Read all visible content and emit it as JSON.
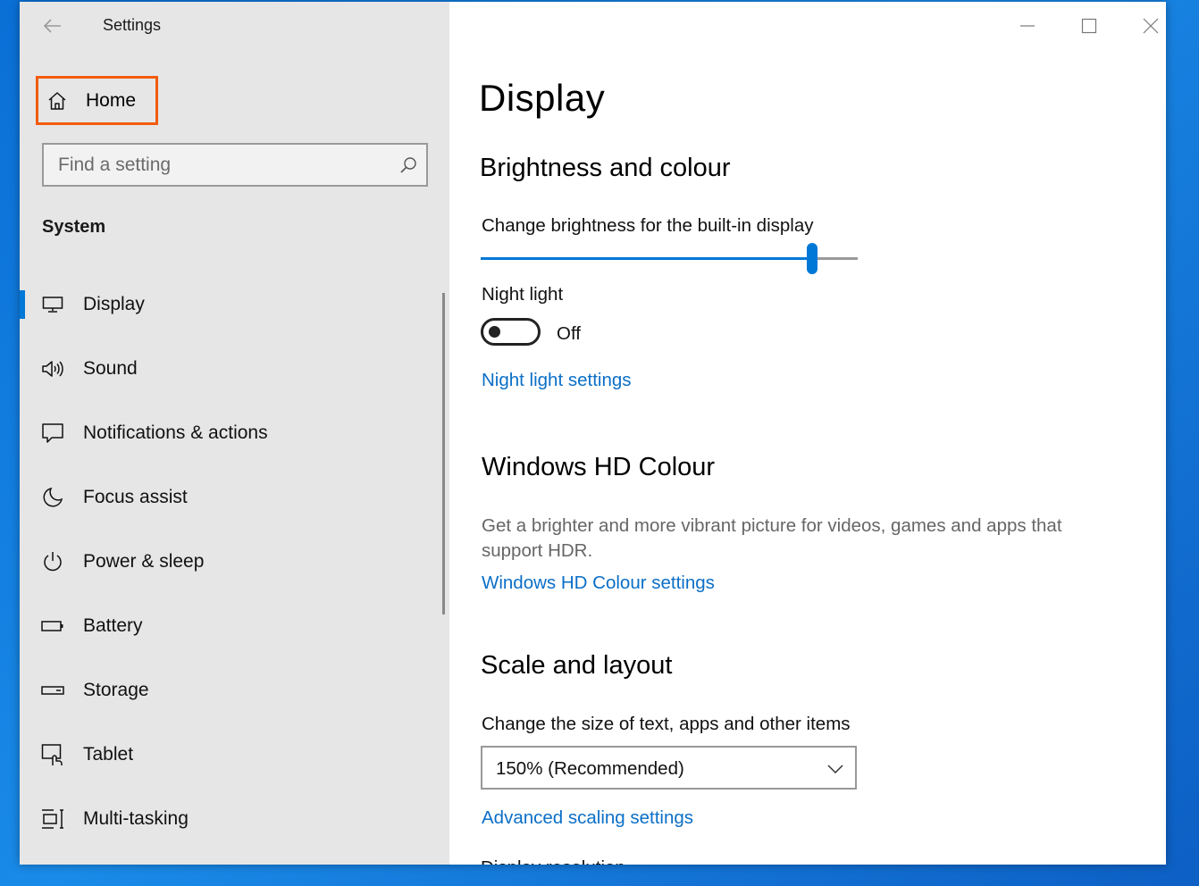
{
  "window": {
    "title": "Settings"
  },
  "sidebar": {
    "home_label": "Home",
    "search_placeholder": "Find a setting",
    "section_label": "System",
    "items": [
      {
        "label": "Display",
        "icon": "monitor-icon",
        "active": true
      },
      {
        "label": "Sound",
        "icon": "speaker-icon"
      },
      {
        "label": "Notifications & actions",
        "icon": "notification-icon"
      },
      {
        "label": "Focus assist",
        "icon": "moon-icon"
      },
      {
        "label": "Power & sleep",
        "icon": "power-icon"
      },
      {
        "label": "Battery",
        "icon": "battery-icon"
      },
      {
        "label": "Storage",
        "icon": "storage-icon"
      },
      {
        "label": "Tablet",
        "icon": "tablet-icon"
      },
      {
        "label": "Multi-tasking",
        "icon": "multitasking-icon"
      }
    ]
  },
  "main": {
    "page_title": "Display",
    "brightness": {
      "heading": "Brightness and colour",
      "slider_label": "Change brightness for the built-in display",
      "slider_value": 0.88,
      "night_light_label": "Night light",
      "night_light_state": "Off",
      "night_light_link": "Night light settings"
    },
    "hdr": {
      "heading": "Windows HD Colour",
      "description": "Get a brighter and more vibrant picture for videos, games and apps that support HDR.",
      "link": "Windows HD Colour settings"
    },
    "scale": {
      "heading": "Scale and layout",
      "size_label": "Change the size of text, apps and other items",
      "size_value": "150% (Recommended)",
      "advanced_link": "Advanced scaling settings",
      "next_label": "Display resolution"
    }
  },
  "colors": {
    "accent": "#0078d7",
    "link": "#0b6fc7",
    "highlight_box": "#f25c0f"
  }
}
